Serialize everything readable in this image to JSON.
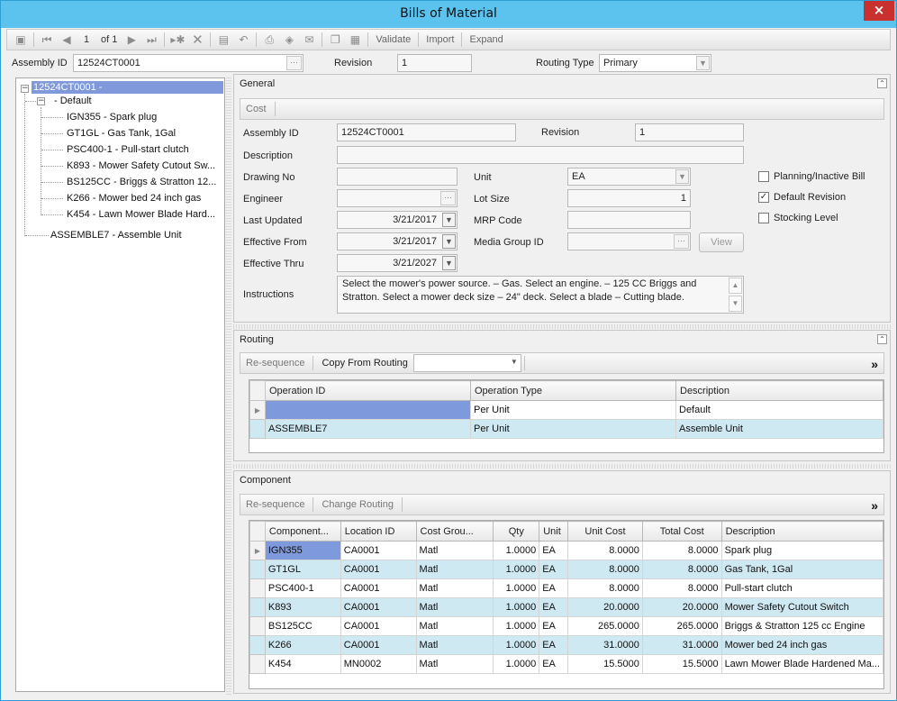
{
  "window": {
    "title": "Bills of Material",
    "close_label": "×"
  },
  "toolbar": {
    "page_label": "1",
    "of_label": "of 1",
    "validate": "Validate",
    "import": "Import",
    "expand": "Expand"
  },
  "header": {
    "assembly_label": "Assembly ID",
    "assembly_value": "12524CT0001",
    "revision_label": "Revision",
    "revision_value": "1",
    "routing_type_label": "Routing Type",
    "routing_type_value": "Primary"
  },
  "tree": {
    "root": "12524CT0001 -",
    "default_node": "- Default",
    "children": [
      "IGN355 - Spark plug",
      "GT1GL - Gas Tank, 1Gal",
      "PSC400-1 - Pull-start clutch",
      "K893 - Mower Safety Cutout Sw...",
      "BS125CC - Briggs & Stratton 12...",
      "K266 - Mower bed 24 inch gas",
      "K454 - Lawn Mower Blade Hard..."
    ],
    "assemble": "ASSEMBLE7 - Assemble Unit"
  },
  "general": {
    "title": "General",
    "cost_button": "Cost",
    "assembly_id_label": "Assembly ID",
    "assembly_id": "12524CT0001",
    "revision_label": "Revision",
    "revision": "1",
    "description_label": "Description",
    "description": "",
    "drawing_no_label": "Drawing No",
    "drawing_no": "",
    "unit_label": "Unit",
    "unit": "EA",
    "engineer_label": "Engineer",
    "engineer": "",
    "lot_size_label": "Lot Size",
    "lot_size": "1",
    "last_updated_label": "Last Updated",
    "last_updated": "3/21/2017",
    "mrp_code_label": "MRP Code",
    "mrp_code": "",
    "effective_from_label": "Effective From",
    "effective_from": "3/21/2017",
    "media_group_label": "Media Group ID",
    "media_group": "",
    "view_button": "View",
    "effective_thru_label": "Effective Thru",
    "effective_thru": "3/21/2027",
    "instructions_label": "Instructions",
    "instructions": "Select the mower's power source. – Gas. Select an engine. – 125 CC Briggs and Stratton. Select a mower deck size – 24\" deck. Select a blade – Cutting blade.",
    "planning_label": "Planning/Inactive Bill",
    "planning_checked": false,
    "default_revision_label": "Default Revision",
    "default_revision_checked": true,
    "stocking_label": "Stocking Level",
    "stocking_checked": false
  },
  "routing": {
    "title": "Routing",
    "resequence": "Re-sequence",
    "copy_from": "Copy From Routing",
    "columns": [
      "Operation ID",
      "Operation Type",
      "Description"
    ],
    "rows": [
      {
        "op_id": "",
        "op_type": "Per Unit",
        "desc": "Default"
      },
      {
        "op_id": "ASSEMBLE7",
        "op_type": "Per Unit",
        "desc": "Assemble Unit"
      }
    ]
  },
  "component": {
    "title": "Component",
    "resequence": "Re-sequence",
    "change_routing": "Change Routing",
    "columns": [
      "Component...",
      "Location ID",
      "Cost Grou...",
      "Qty",
      "Unit",
      "Unit Cost",
      "Total Cost",
      "Description"
    ],
    "rows": [
      {
        "comp": "IGN355",
        "loc": "CA0001",
        "cg": "Matl",
        "qty": "1.0000",
        "unit": "EA",
        "uc": "8.0000",
        "tc": "8.0000",
        "desc": "Spark plug"
      },
      {
        "comp": "GT1GL",
        "loc": "CA0001",
        "cg": "Matl",
        "qty": "1.0000",
        "unit": "EA",
        "uc": "8.0000",
        "tc": "8.0000",
        "desc": "Gas Tank, 1Gal"
      },
      {
        "comp": "PSC400-1",
        "loc": "CA0001",
        "cg": "Matl",
        "qty": "1.0000",
        "unit": "EA",
        "uc": "8.0000",
        "tc": "8.0000",
        "desc": "Pull-start clutch"
      },
      {
        "comp": "K893",
        "loc": "CA0001",
        "cg": "Matl",
        "qty": "1.0000",
        "unit": "EA",
        "uc": "20.0000",
        "tc": "20.0000",
        "desc": "Mower Safety Cutout Switch"
      },
      {
        "comp": "BS125CC",
        "loc": "CA0001",
        "cg": "Matl",
        "qty": "1.0000",
        "unit": "EA",
        "uc": "265.0000",
        "tc": "265.0000",
        "desc": "Briggs & Stratton 125 cc Engine"
      },
      {
        "comp": "K266",
        "loc": "CA0001",
        "cg": "Matl",
        "qty": "1.0000",
        "unit": "EA",
        "uc": "31.0000",
        "tc": "31.0000",
        "desc": "Mower bed 24 inch gas"
      },
      {
        "comp": "K454",
        "loc": "MN0002",
        "cg": "Matl",
        "qty": "1.0000",
        "unit": "EA",
        "uc": "15.5000",
        "tc": "15.5000",
        "desc": "Lawn Mower Blade Hardened Ma..."
      }
    ]
  }
}
